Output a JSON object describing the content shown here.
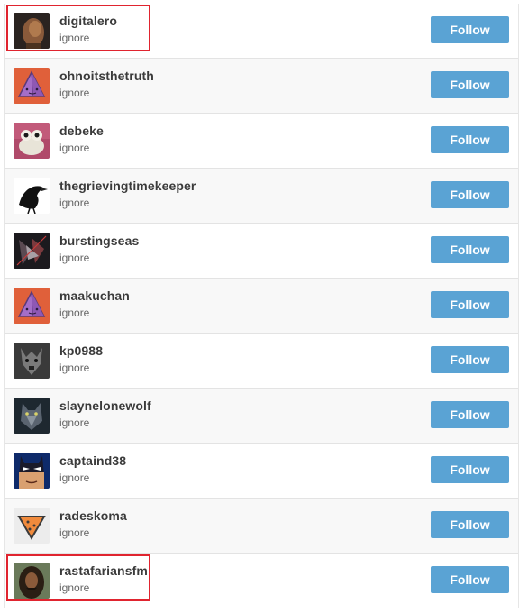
{
  "users": [
    {
      "username": "digitalero",
      "ignore_label": "ignore",
      "follow_label": "Follow",
      "avatar": "bronze-face-avatar",
      "highlighted": true
    },
    {
      "username": "ohnoitsthetruth",
      "ignore_label": "ignore",
      "follow_label": "Follow",
      "avatar": "purple-pyramid-avatar",
      "highlighted": false
    },
    {
      "username": "debeke",
      "ignore_label": "ignore",
      "follow_label": "Follow",
      "avatar": "stuffed-creature-avatar",
      "highlighted": false
    },
    {
      "username": "thegrievingtimekeeper",
      "ignore_label": "ignore",
      "follow_label": "Follow",
      "avatar": "raven-avatar",
      "highlighted": false
    },
    {
      "username": "burstingseas",
      "ignore_label": "ignore",
      "follow_label": "Follow",
      "avatar": "dark-mecha-avatar",
      "highlighted": false
    },
    {
      "username": "maakuchan",
      "ignore_label": "ignore",
      "follow_label": "Follow",
      "avatar": "purple-pyramid-avatar",
      "highlighted": false
    },
    {
      "username": "kp0988",
      "ignore_label": "ignore",
      "follow_label": "Follow",
      "avatar": "gray-gargoyle-avatar",
      "highlighted": false
    },
    {
      "username": "slaynelonewolf",
      "ignore_label": "ignore",
      "follow_label": "Follow",
      "avatar": "wolf-avatar",
      "highlighted": false
    },
    {
      "username": "captaind38",
      "ignore_label": "ignore",
      "follow_label": "Follow",
      "avatar": "batman-avatar",
      "highlighted": false
    },
    {
      "username": "radeskoma",
      "ignore_label": "ignore",
      "follow_label": "Follow",
      "avatar": "orange-triangle-avatar",
      "highlighted": false
    },
    {
      "username": "rastafariansfm",
      "ignore_label": "ignore",
      "follow_label": "Follow",
      "avatar": "portrait-avatar",
      "highlighted": true
    }
  ],
  "colors": {
    "follow_button": "#5aa3d4",
    "highlight_border": "#e0242f",
    "row_alt_background": "#f8f8f8"
  }
}
